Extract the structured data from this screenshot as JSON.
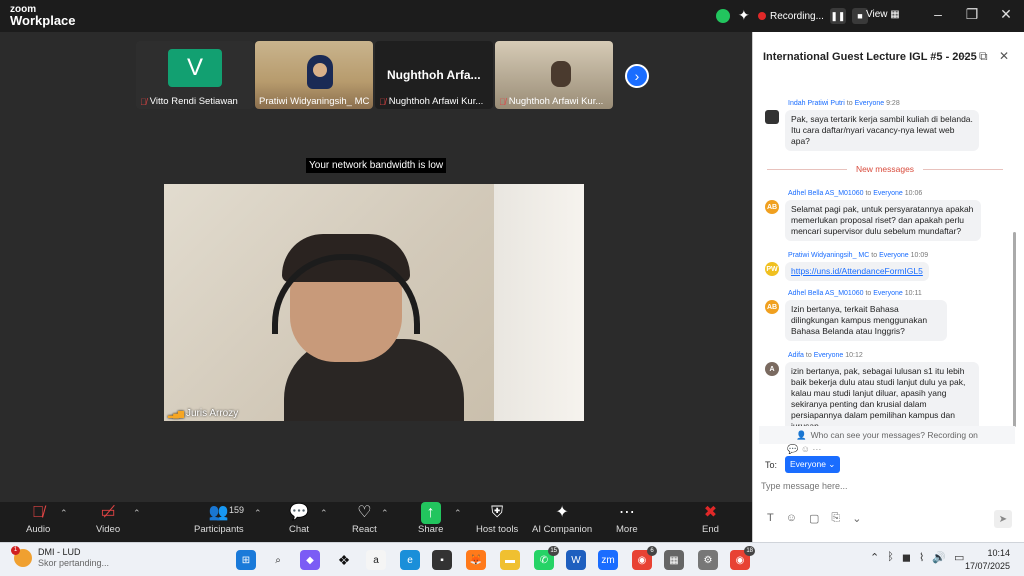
{
  "app": {
    "logo_line1": "zoom",
    "logo_line2": "Workplace"
  },
  "titlebar": {
    "recording_label": "Recording...",
    "pause_icon": "pause-icon",
    "stop_icon": "stop-icon",
    "view_label": "View"
  },
  "thumbnails": [
    {
      "name": "Vitto Rendi Setiawan",
      "avatar_letter": "V",
      "muted": true
    },
    {
      "name": "Pratiwi Widyaningsih_ MC",
      "muted": false
    },
    {
      "name": "Nughthoh Arfawi Kur...",
      "tile_label": "Nughthoh  Arfa...",
      "muted": true
    },
    {
      "name": "Nughthoh Arfawi Kur...",
      "muted": true
    }
  ],
  "stage": {
    "bandwidth_note": "Your network bandwidth is low",
    "speaker_name": "Juris Arrozy"
  },
  "toolbar": {
    "audio": "Audio",
    "video": "Video",
    "participants": "Participants",
    "participants_count": "159",
    "chat": "Chat",
    "react": "React",
    "share": "Share",
    "host_tools": "Host tools",
    "ai_companion": "AI Companion",
    "more": "More",
    "end": "End"
  },
  "chat": {
    "title": "International Guest Lecture IGL #5 - 2025",
    "messages": [
      {
        "sender": "Indah Pratiwi Putri",
        "to": "to",
        "target": "Everyone",
        "time": "9:28",
        "text": "Pak, saya tertarik kerja sambil kuliah di belanda. Itu cara daftar/nyari vacancy-nya lewat web apa?"
      },
      {
        "sender": "Adhel Bella AS_M01060",
        "to": "to",
        "target": "Everyone",
        "time": "10:06",
        "initials": "AB",
        "text": "Selamat pagi pak, untuk persyaratannya apakah memerlukan proposal riset? dan apakah perlu mencari supervisor dulu sebelum mundaftar?"
      },
      {
        "sender": "Pratiwi Widyaningsih_ MC",
        "to": "to",
        "target": "Everyone",
        "time": "10:09",
        "initials": "PW",
        "text": "https://uns.id/AttendanceFormIGL5"
      },
      {
        "sender": "Adhel Bella AS_M01060",
        "to": "to",
        "target": "Everyone",
        "time": "10:11",
        "initials": "AB",
        "text": "Izin bertanya, terkait Bahasa dilingkungan kampus menggunakan Bahasa Belanda atau Inggris?"
      },
      {
        "sender": "Adifa",
        "to": "to",
        "target": "Everyone",
        "time": "10:12",
        "initials": "A",
        "text": "izin bertanya, pak, sebagai lulusan s1 itu lebih baik bekerja dulu atau studi lanjut dulu ya pak, kalau mau studi lanjut diluar, apasih yang sekiranya penting dan krusial dalam persiapannya dalam pemilihan kampus dan jurusan"
      }
    ],
    "new_messages_label": "New messages",
    "who_can_see": "Who can see your messages? Recording on",
    "to_label": "To:",
    "to_target": "Everyone",
    "input_placeholder": "Type message here..."
  },
  "taskbar": {
    "weather_title": "DMI - LUD",
    "weather_sub": "Skor pertanding...",
    "weather_badge": "1",
    "whatsapp_badge": "15",
    "chrome_badge_1": "6",
    "chrome_badge_2": "18",
    "time": "10:14",
    "date": "17/07/2025"
  },
  "colors": {
    "accent": "#1a6dff",
    "chat_new": "#d94c3d",
    "mic_off": "#e04444",
    "end": "#e02828"
  }
}
